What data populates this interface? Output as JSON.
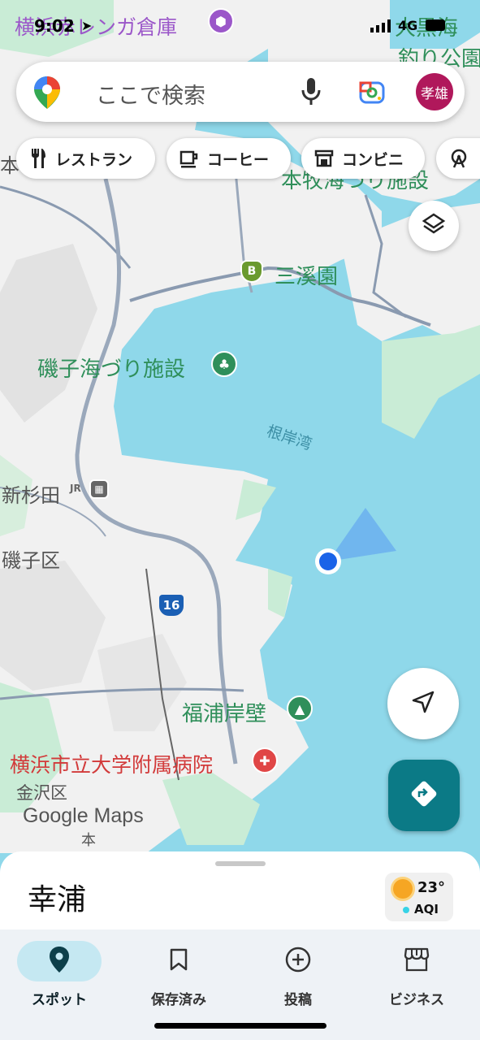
{
  "status_bar": {
    "time": "9:02",
    "network": "4G"
  },
  "search": {
    "placeholder": "ここで検索",
    "avatar_text": "孝雄"
  },
  "chips": [
    {
      "label": "レストラン",
      "icon": "fork-knife-icon"
    },
    {
      "label": "コーヒー",
      "icon": "coffee-cup-icon"
    },
    {
      "label": "コンビニ",
      "icon": "store-icon"
    }
  ],
  "map_labels": {
    "yokohama_renga": "横浜赤レンガ倉庫",
    "daikoku": "大黒海",
    "daikoku2": "釣り公園",
    "honmoku": "本牧海づり施設",
    "sankeien": "三溪園",
    "isogo_fishing": "磯子海づり施設",
    "negishi_bay": "根岸湾",
    "shinsugita": "新杉田",
    "isogo_ward": "磯子区",
    "fukuura": "福浦岸壁",
    "hospital": "横浜市立大学附属病院",
    "kanazawa": "金沢区",
    "route_16": "16",
    "bus_b": "B",
    "jr": "JR",
    "hon_left": "本",
    "hon_bottom": "本"
  },
  "watermark": "Google Maps",
  "bottom_sheet": {
    "place_name": "幸浦",
    "temperature": "23°",
    "aqi_label": "AQI"
  },
  "bottom_nav": [
    {
      "label": "スポット",
      "icon": "location-pin-icon",
      "active": true
    },
    {
      "label": "保存済み",
      "icon": "bookmark-icon",
      "active": false
    },
    {
      "label": "投稿",
      "icon": "add-circle-icon",
      "active": false
    },
    {
      "label": "ビジネス",
      "icon": "storefront-icon",
      "active": false
    }
  ],
  "colors": {
    "water": "#8fd8ea",
    "land": "#f2f2f2",
    "park": "#c9ecd6",
    "accent": "#0b7a86",
    "avatar": "#b0185b"
  }
}
